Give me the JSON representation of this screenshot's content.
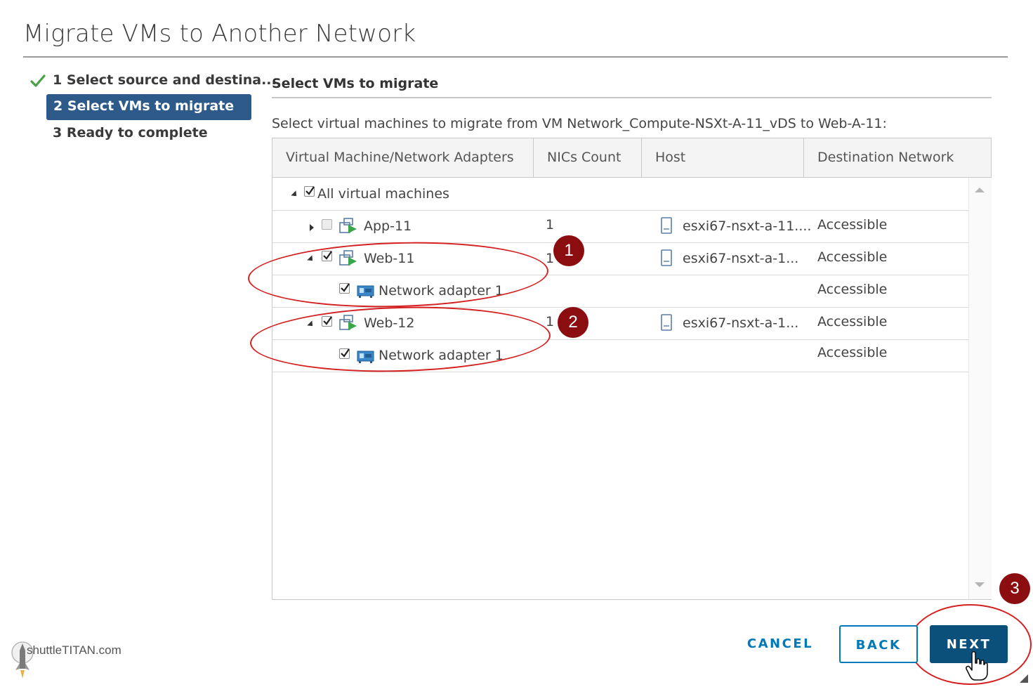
{
  "dialog": {
    "title": "Migrate VMs to Another Network"
  },
  "steps": [
    {
      "label": "1 Select source and destina...",
      "state": "done"
    },
    {
      "label": "2 Select VMs to migrate",
      "state": "active"
    },
    {
      "label": "3 Ready to complete",
      "state": "pending"
    }
  ],
  "section": {
    "title": "Select VMs to migrate",
    "instruction": "Select virtual machines to migrate from VM Network_Compute-NSXt-A-11_vDS to Web-A-11:"
  },
  "table": {
    "columns": [
      "Virtual Machine/Network Adapters",
      "NICs Count",
      "Host",
      "Destination Network"
    ],
    "rows": [
      {
        "name": "All virtual machines",
        "type": "group",
        "checked": true,
        "expanded": true,
        "nics": "",
        "host": "",
        "dest": ""
      },
      {
        "name": "App-11",
        "type": "vm",
        "checked": false,
        "expanded": false,
        "nics": "1",
        "host": "esxi67-nsxt-a-11....",
        "dest": "Accessible"
      },
      {
        "name": "Web-11",
        "type": "vm",
        "checked": true,
        "expanded": true,
        "nics": "1",
        "host": "esxi67-nsxt-a-1...",
        "dest": "Accessible"
      },
      {
        "name": "Network adapter 1",
        "type": "adapter",
        "checked": true,
        "nics": "",
        "host": "",
        "dest": "Accessible"
      },
      {
        "name": "Web-12",
        "type": "vm",
        "checked": true,
        "expanded": true,
        "nics": "1",
        "host": "esxi67-nsxt-a-1...",
        "dest": "Accessible"
      },
      {
        "name": "Network adapter 1",
        "type": "adapter",
        "checked": true,
        "nics": "",
        "host": "",
        "dest": "Accessible"
      }
    ]
  },
  "callouts": [
    "1",
    "2",
    "3"
  ],
  "footer": {
    "cancel": "CANCEL",
    "back": "BACK",
    "next": "NEXT"
  },
  "watermark": "shuttleTITAN.com",
  "colors": {
    "primary": "#0079b8",
    "next_button": "#0b4f7b",
    "active_step": "#2e5a8a",
    "callout": "#d42020",
    "badge": "#8b0d10"
  }
}
